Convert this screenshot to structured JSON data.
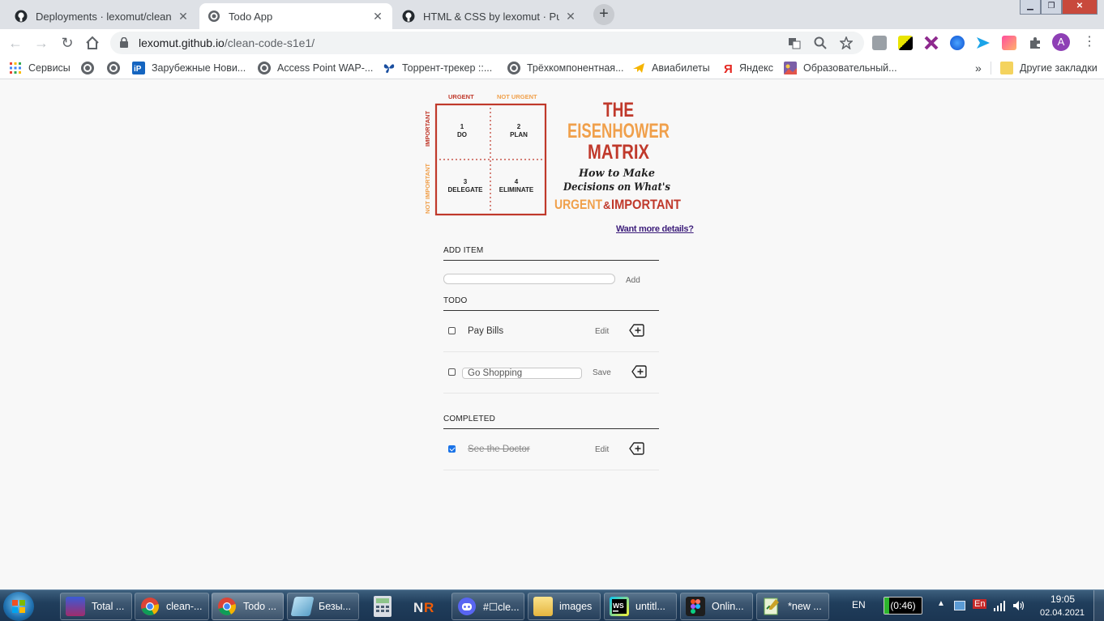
{
  "browser": {
    "tabs": [
      {
        "title": "Deployments · lexomut/clean-co",
        "icon": "github-icon"
      },
      {
        "title": "Todo App",
        "icon": "globe-icon"
      },
      {
        "title": "HTML & CSS by lexomut · Pull Re",
        "icon": "github-icon"
      }
    ],
    "new_tab_glyph": "+",
    "url_host": "lexomut.github.io",
    "url_path": "/clean-code-s1e1/",
    "avatar_letter": "A",
    "bookmarks": [
      {
        "label": "Сервисы",
        "icon": "apps-icon"
      },
      {
        "label": "",
        "icon": "globe-icon"
      },
      {
        "label": "",
        "icon": "globe-icon"
      },
      {
        "label": "Зарубежные Нови...",
        "icon": "ip-icon"
      },
      {
        "label": "Access Point WAP-...",
        "icon": "globe-icon"
      },
      {
        "label": "Торрент-трекер ::...",
        "icon": "butterfly-icon"
      },
      {
        "label": "Трёхкомпонентная...",
        "icon": "globe-icon"
      },
      {
        "label": "Авиабилеты",
        "icon": "plane-icon"
      },
      {
        "label": "Яндекс",
        "icon": "yandex-icon"
      },
      {
        "label": "Образовательный...",
        "icon": "image-icon"
      }
    ],
    "bookmarks_more": "»",
    "other_bookmarks": "Другие закладки"
  },
  "app": {
    "image": {
      "urgent": "URGENT",
      "not_urgent": "NOT URGENT",
      "important": "IMPORTANT",
      "not_important": "NOT IMPORTANT",
      "q1_num": "1",
      "q1": "DO",
      "q2_num": "2",
      "q2": "PLAN",
      "q3_num": "3",
      "q3": "DELEGATE",
      "q4_num": "4",
      "q4": "ELIMINATE",
      "title_the": "THE",
      "title_eisenhower": "EISENHOWER",
      "title_matrix": "MATRIX",
      "sub1": "How to Make",
      "sub2": "Decisions on What's",
      "sub_urgent": "URGENT",
      "sub_amp": "&",
      "sub_important": "IMPORTANT"
    },
    "more_link": "Want more details?",
    "add_heading": "ADD ITEM",
    "add_button": "Add",
    "new_item_value": "",
    "todo_heading": "TODO",
    "todo_items": [
      {
        "text": "Pay Bills",
        "button": "Edit",
        "checked": false,
        "editing": false
      },
      {
        "text": "Go Shopping",
        "button": "Save",
        "checked": false,
        "editing": true
      }
    ],
    "completed_heading": "COMPLETED",
    "completed_items": [
      {
        "text": "See the Doctor",
        "button": "Edit",
        "checked": true
      }
    ]
  },
  "taskbar": {
    "items": [
      {
        "label": "Total ...",
        "icon": "total-commander-icon"
      },
      {
        "label": "clean-...",
        "icon": "chrome-icon"
      },
      {
        "label": "Todo ...",
        "icon": "chrome-icon"
      },
      {
        "label": "Безы...",
        "icon": "paint-icon"
      },
      {
        "label": "",
        "icon": "calculator-icon"
      },
      {
        "label": "",
        "icon": "nr-icon"
      },
      {
        "label": "#☐cle...",
        "icon": "discord-icon"
      },
      {
        "label": "images",
        "icon": "folder-icon"
      },
      {
        "label": "untitl...",
        "icon": "webstorm-icon"
      },
      {
        "label": "Onlin...",
        "icon": "figma-icon"
      },
      {
        "label": "*new ...",
        "icon": "notepad-icon"
      }
    ],
    "lang": "EN",
    "battery": "(0:46)",
    "tray_lang": "En",
    "time": "19:05",
    "date": "02.04.2021"
  },
  "colors": {
    "matrix_red": "#c0392b",
    "matrix_orange": "#f0a04b",
    "link": "#3c1d7a",
    "check_blue": "#1a73e8"
  }
}
